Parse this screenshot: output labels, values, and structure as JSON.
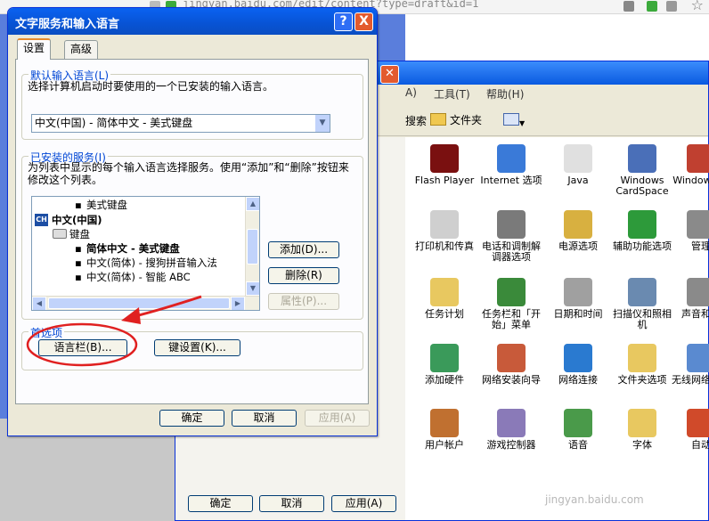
{
  "browser": {
    "url": "jingyan.baidu.com/edit/content?type=draft&id=1"
  },
  "control_panel": {
    "menus": [
      "A)",
      "工具(T)",
      "帮助(H)"
    ],
    "toolbar": {
      "search_label": "搜索",
      "folders_label": "文件夹"
    },
    "items": [
      {
        "label": "Flash Player",
        "icon": "flash-icon",
        "color": "#7a1010"
      },
      {
        "label": "Internet 选项",
        "icon": "internet-options-icon",
        "color": "#3a7ad8"
      },
      {
        "label": "Java",
        "icon": "java-icon",
        "color": "#e0e0e0"
      },
      {
        "label": "Windows CardSpace",
        "icon": "cardspace-icon",
        "color": "#4a6fb8"
      },
      {
        "label": "Windows 火",
        "icon": "firewall-icon",
        "color": "#c04030"
      },
      {
        "label": "打印机和传真",
        "icon": "printer-icon",
        "color": "#cfcfcf"
      },
      {
        "label": "电话和调制解调器选项",
        "icon": "phone-modem-icon",
        "color": "#7a7a7a"
      },
      {
        "label": "电源选项",
        "icon": "power-icon",
        "color": "#d8b040"
      },
      {
        "label": "辅助功能选项",
        "icon": "accessibility-icon",
        "color": "#2d9a3a"
      },
      {
        "label": "管理",
        "icon": "admin-tools-icon",
        "color": "#8a8a8a"
      },
      {
        "label": "任务计划",
        "icon": "scheduled-tasks-icon",
        "color": "#e8c860"
      },
      {
        "label": "任务栏和「开始」菜单",
        "icon": "taskbar-icon",
        "color": "#3a8a3a"
      },
      {
        "label": "日期和时间",
        "icon": "datetime-icon",
        "color": "#a0a0a0"
      },
      {
        "label": "扫描仪和照相机",
        "icon": "scanner-icon",
        "color": "#6a8ab0"
      },
      {
        "label": "声音和设",
        "icon": "sound-icon",
        "color": "#8a8a8a"
      },
      {
        "label": "添加硬件",
        "icon": "add-hardware-icon",
        "color": "#3a9a5a"
      },
      {
        "label": "网络安装向导",
        "icon": "network-setup-icon",
        "color": "#c85a3a"
      },
      {
        "label": "网络连接",
        "icon": "network-connections-icon",
        "color": "#2a7ad0"
      },
      {
        "label": "文件夹选项",
        "icon": "folder-options-icon",
        "color": "#e8c860"
      },
      {
        "label": "无线网络装向",
        "icon": "wireless-icon",
        "color": "#5a8ad0"
      },
      {
        "label": "用户帐户",
        "icon": "user-accounts-icon",
        "color": "#c07030"
      },
      {
        "label": "游戏控制器",
        "icon": "game-controller-icon",
        "color": "#8a7ab8"
      },
      {
        "label": "语音",
        "icon": "speech-icon",
        "color": "#4a9a4a"
      },
      {
        "label": "字体",
        "icon": "fonts-icon",
        "color": "#e8c860"
      },
      {
        "label": "自动",
        "icon": "auto-update-icon",
        "color": "#d04a2a"
      }
    ],
    "back_buttons": {
      "ok": "确定",
      "cancel": "取消",
      "apply": "应用(A)"
    }
  },
  "dialog": {
    "title": "文字服务和输入语言",
    "help_button": "?",
    "close_button": "X",
    "tabs": {
      "settings": "设置",
      "advanced": "高级"
    },
    "default_lang": {
      "group_label": "默认输入语言(L)",
      "description": "选择计算机启动时要使用的一个已安装的输入语言。",
      "selected": "中文(中国) - 简体中文 - 美式键盘"
    },
    "installed": {
      "group_label": "已安装的服务(I)",
      "description": "为列表中显示的每个输入语言选择服务。使用“添加”和“删除”按钮来修改这个列表。",
      "tree": {
        "row1": "美式键盘",
        "row2_badge": "CH",
        "row2": "中文(中国)",
        "row3": "键盘",
        "row4": "简体中文 - 美式键盘",
        "row5": "中文(简体) - 搜狗拼音输入法",
        "row6": "中文(简体) - 智能 ABC"
      },
      "add_button": "添加(D)...",
      "remove_button": "删除(R)",
      "properties_button": "属性(P)..."
    },
    "preferences": {
      "group_label": "首选项",
      "langbar_button": "语言栏(B)...",
      "keysettings_button": "键设置(K)..."
    },
    "footer": {
      "ok": "确定",
      "cancel": "取消",
      "apply": "应用(A)"
    }
  },
  "watermark": "jingyan.baidu.com",
  "annotation_color": "#e02020"
}
